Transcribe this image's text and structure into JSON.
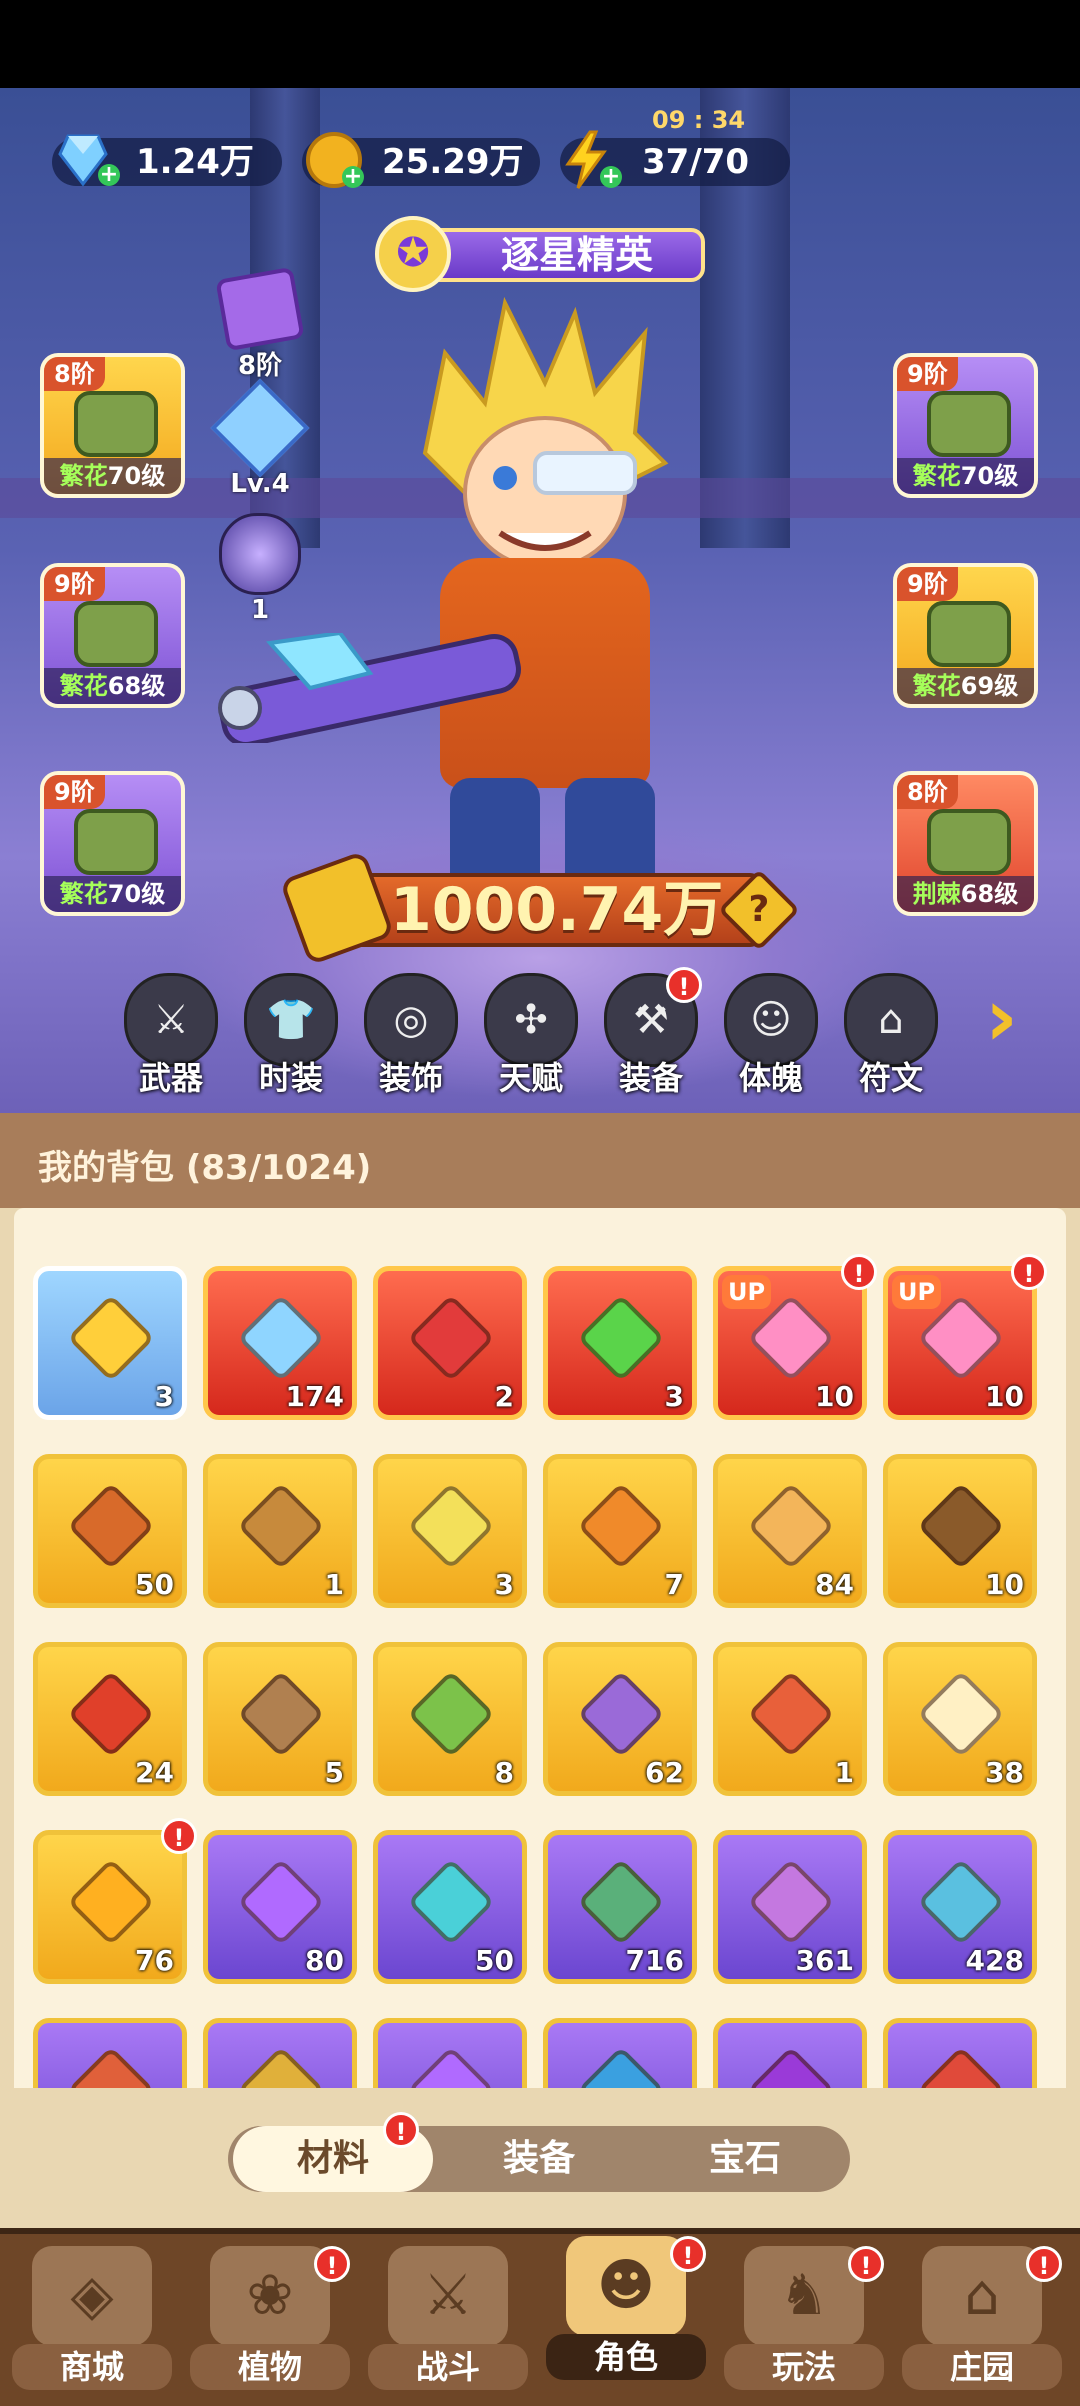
{
  "currency": {
    "diamonds": "1.24万",
    "gold": "25.29万",
    "energy": "37/70",
    "energy_timer": "09 : 34"
  },
  "hero": {
    "rank_title": "逐星精英",
    "power": "1000.74万",
    "rune_tier": "8阶",
    "crystal_level": "Lv.4",
    "orb_count": "1"
  },
  "equipment": {
    "left": [
      {
        "tier": "8阶",
        "quality": "繁花",
        "level": "70级",
        "color": "gold",
        "icon": "hat-icon"
      },
      {
        "tier": "9阶",
        "quality": "繁花",
        "level": "68级",
        "color": "purple",
        "icon": "gloves-icon"
      },
      {
        "tier": "9阶",
        "quality": "繁花",
        "level": "70级",
        "color": "purple",
        "icon": "pants-icon"
      }
    ],
    "right": [
      {
        "tier": "9阶",
        "quality": "繁花",
        "level": "70级",
        "color": "purple",
        "icon": "shirt-icon"
      },
      {
        "tier": "9阶",
        "quality": "繁花",
        "level": "69级",
        "color": "gold",
        "icon": "belt-icon"
      },
      {
        "tier": "8阶",
        "quality": "荆棘",
        "level": "68级",
        "color": "red",
        "icon": "boots-icon"
      }
    ]
  },
  "categories": [
    {
      "label": "武器",
      "glyph": "⚔",
      "icon": "weapon-icon",
      "badge": false
    },
    {
      "label": "时装",
      "glyph": "👕",
      "icon": "fashion-icon",
      "badge": false
    },
    {
      "label": "装饰",
      "glyph": "◎",
      "icon": "mask-icon",
      "badge": false
    },
    {
      "label": "天赋",
      "glyph": "✣",
      "icon": "talent-icon",
      "badge": false
    },
    {
      "label": "装备",
      "glyph": "⚒",
      "icon": "equipment-icon",
      "badge": true
    },
    {
      "label": "体魄",
      "glyph": "☺",
      "icon": "physique-icon",
      "badge": false
    },
    {
      "label": "符文",
      "glyph": "⌂",
      "icon": "rune-icon",
      "badge": false
    }
  ],
  "bag": {
    "title": "我的背包 (83/1024)",
    "items": [
      {
        "qty": "3",
        "color": "blue",
        "icon": "star-icon",
        "hue": "#ffcf3a",
        "badge": false,
        "up": false
      },
      {
        "qty": "174",
        "color": "red",
        "icon": "crystal-icon",
        "hue": "#8fd5ff",
        "badge": false,
        "up": false
      },
      {
        "qty": "2",
        "color": "red",
        "icon": "potion-icon",
        "hue": "#e23b3b",
        "badge": false,
        "up": false
      },
      {
        "qty": "3",
        "color": "red",
        "icon": "canister-icon",
        "hue": "#5ad44a",
        "badge": false,
        "up": false
      },
      {
        "qty": "10",
        "color": "red",
        "icon": "flame-icon",
        "hue": "#ff8fc4",
        "badge": true,
        "up": true
      },
      {
        "qty": "10",
        "color": "red",
        "icon": "flame-icon",
        "hue": "#ff8fc4",
        "badge": true,
        "up": true
      },
      {
        "qty": "50",
        "color": "gold",
        "icon": "elixir-icon",
        "hue": "#d86a2a",
        "badge": false,
        "up": false
      },
      {
        "qty": "1",
        "color": "gold",
        "icon": "key-icon",
        "hue": "#c78a3c",
        "badge": false,
        "up": false
      },
      {
        "qty": "3",
        "color": "gold",
        "icon": "seed-icon",
        "hue": "#f3e05a",
        "badge": false,
        "up": false
      },
      {
        "qty": "7",
        "color": "gold",
        "icon": "potion-icon",
        "hue": "#f08a2a",
        "badge": false,
        "up": false
      },
      {
        "qty": "84",
        "color": "gold",
        "icon": "sand-icon",
        "hue": "#f3b55a",
        "badge": false,
        "up": false
      },
      {
        "qty": "10",
        "color": "gold",
        "icon": "ore-icon",
        "hue": "#8a5a2a",
        "badge": false,
        "up": false
      },
      {
        "qty": "24",
        "color": "gold",
        "icon": "flower-icon",
        "hue": "#e0402a",
        "badge": false,
        "up": false
      },
      {
        "qty": "5",
        "color": "gold",
        "icon": "pot-icon",
        "hue": "#b08050",
        "badge": false,
        "up": false
      },
      {
        "qty": "8",
        "color": "gold",
        "icon": "sprayer-icon",
        "hue": "#7cc24a",
        "badge": false,
        "up": false
      },
      {
        "qty": "62",
        "color": "gold",
        "icon": "book-icon",
        "hue": "#9a6ad8",
        "badge": false,
        "up": false
      },
      {
        "qty": "1",
        "color": "gold",
        "icon": "gem-icon",
        "hue": "#e8603a",
        "badge": false,
        "up": false
      },
      {
        "qty": "38",
        "color": "gold",
        "icon": "knot-icon",
        "hue": "#fff0c4",
        "badge": false,
        "up": false
      },
      {
        "qty": "76",
        "color": "gold",
        "icon": "fire-icon",
        "hue": "#ffb020",
        "badge": true,
        "up": false
      },
      {
        "qty": "80",
        "color": "purple",
        "icon": "bottle-icon",
        "hue": "#b06aff",
        "badge": false,
        "up": false
      },
      {
        "qty": "50",
        "color": "purple",
        "icon": "leaf-icon",
        "hue": "#4ad0d8",
        "badge": false,
        "up": false
      },
      {
        "qty": "716",
        "color": "purple",
        "icon": "scroll-icon",
        "hue": "#5ab07a",
        "badge": false,
        "up": false
      },
      {
        "qty": "361",
        "color": "purple",
        "icon": "scroll-icon",
        "hue": "#c478e0",
        "badge": false,
        "up": false
      },
      {
        "qty": "428",
        "color": "purple",
        "icon": "scroll-icon",
        "hue": "#5ac0e0",
        "badge": false,
        "up": false
      },
      {
        "qty": "",
        "color": "purple",
        "icon": "scroll-icon",
        "hue": "#e0603a",
        "badge": false,
        "up": false
      },
      {
        "qty": "",
        "color": "purple",
        "icon": "scroll-icon",
        "hue": "#e0b03a",
        "badge": false,
        "up": false
      },
      {
        "qty": "",
        "color": "purple",
        "icon": "potion-icon",
        "hue": "#b06aff",
        "badge": false,
        "up": false
      },
      {
        "qty": "",
        "color": "purple",
        "icon": "crystal-icon",
        "hue": "#3aa0e0",
        "badge": false,
        "up": false
      },
      {
        "qty": "",
        "color": "purple",
        "icon": "onion-icon",
        "hue": "#9a3ad8",
        "badge": false,
        "up": false
      },
      {
        "qty": "",
        "color": "purple",
        "icon": "fruit-basket-icon",
        "hue": "#e04a3a",
        "badge": false,
        "up": false
      }
    ],
    "up_label": "UP"
  },
  "tabs": [
    {
      "label": "材料",
      "active": true,
      "badge": true
    },
    {
      "label": "装备",
      "active": false,
      "badge": false
    },
    {
      "label": "宝石",
      "active": false,
      "badge": false
    }
  ],
  "nav": [
    {
      "label": "商城",
      "glyph": "◈",
      "icon": "shop-icon",
      "active": false,
      "badge": false
    },
    {
      "label": "植物",
      "glyph": "❀",
      "icon": "plant-icon",
      "active": false,
      "badge": true
    },
    {
      "label": "战斗",
      "glyph": "⚔",
      "icon": "battle-icon",
      "active": false,
      "badge": false
    },
    {
      "label": "角色",
      "glyph": "☻",
      "icon": "character-icon",
      "active": true,
      "badge": true
    },
    {
      "label": "玩法",
      "glyph": "♞",
      "icon": "gameplay-icon",
      "active": false,
      "badge": true
    },
    {
      "label": "庄园",
      "glyph": "⌂",
      "icon": "manor-icon",
      "active": false,
      "badge": true
    }
  ],
  "badge_mark": "!"
}
